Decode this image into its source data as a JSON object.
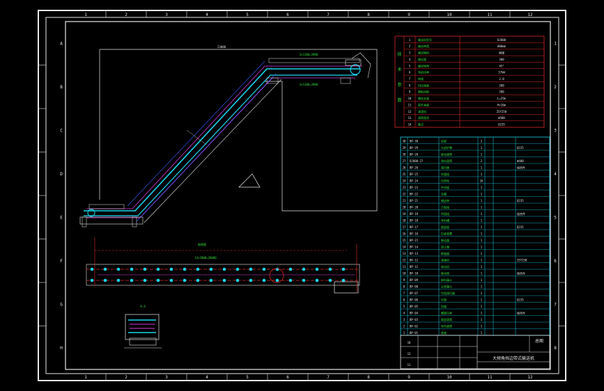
{
  "drawing": {
    "title_block": {
      "drawing_title": "大倾角挡边带式输送机",
      "rows": [
        "18",
        "12",
        "11"
      ],
      "mark": "总图"
    },
    "border": {
      "columns": [
        "1",
        "2",
        "3",
        "4",
        "5",
        "6",
        "7",
        "8",
        "9",
        "10",
        "11",
        "12"
      ],
      "rows": [
        "A",
        "B",
        "C",
        "D",
        "E",
        "F",
        "G",
        "H"
      ]
    },
    "tech_table": {
      "rows": [
        {
          "no": "1",
          "name": "输送机型号",
          "value": "DJ800"
        },
        {
          "no": "2",
          "name": "输送带宽",
          "value": "800mm"
        },
        {
          "no": "3",
          "name": "输送物料",
          "value": "原煤"
        },
        {
          "no": "4",
          "name": "输送量",
          "value": "300"
        },
        {
          "no": "5",
          "name": "输送倾角",
          "value": "45°"
        },
        {
          "no": "6",
          "name": "电机功率",
          "value": "37kW"
        },
        {
          "no": "7",
          "name": "带速",
          "value": "2.0"
        },
        {
          "no": "8",
          "name": "挡边高度",
          "value": "200"
        },
        {
          "no": "9",
          "name": "隔板间距",
          "value": "280"
        },
        {
          "no": "10",
          "name": "输送长度",
          "value": "L=25m"
        },
        {
          "no": "11",
          "name": "提升高度",
          "value": "H=16m"
        },
        {
          "no": "12",
          "name": "减速机",
          "value": "ZSY250"
        },
        {
          "no": "13",
          "name": "滚筒直径",
          "value": "Φ500"
        },
        {
          "no": "14",
          "name": "备注",
          "value": "Q235"
        }
      ],
      "side_label": [
        "技",
        "术",
        "参",
        "数"
      ]
    },
    "dims": {
      "top_overall": "23000",
      "upper_beam": "3×1300=3900",
      "lower_beam": "3×1300=3900",
      "plan_span": "14×2000=28000",
      "section": "A-A",
      "plan_title": "俯视图"
    },
    "parts_list": [
      {
        "no": "30",
        "code": "BP-30",
        "name": "机架",
        "qty": "2",
        "note": ""
      },
      {
        "no": "29",
        "code": "BP-29",
        "name": "头部护罩",
        "qty": "1",
        "note": "Q235"
      },
      {
        "no": "28",
        "code": "BP-28",
        "name": "驱动滚筒",
        "qty": "1",
        "note": ""
      },
      {
        "no": "27",
        "code": "DJ800-27",
        "name": "改向滚筒",
        "qty": "2",
        "note": "Φ400"
      },
      {
        "no": "26",
        "code": "BP-26",
        "name": "清扫器",
        "qty": "1",
        "note": "组合件"
      },
      {
        "no": "25",
        "code": "BP-25",
        "name": "托辊组",
        "qty": "1",
        "note": ""
      },
      {
        "no": "24",
        "code": "BP-24",
        "name": "压带轮",
        "qty": "16",
        "note": ""
      },
      {
        "no": "23",
        "code": "BP-23",
        "name": "中间架",
        "qty": "1",
        "note": ""
      },
      {
        "no": "22",
        "code": "BP-22",
        "name": "支腿",
        "qty": "1",
        "note": ""
      },
      {
        "no": "21",
        "code": "BP-21",
        "name": "输送带",
        "qty": "1",
        "note": "Q235"
      },
      {
        "no": "20",
        "code": "BP-20",
        "name": "凸弧段",
        "qty": "1",
        "note": ""
      },
      {
        "no": "19",
        "code": "BP-19",
        "name": "凹弧段",
        "qty": "1",
        "note": "组合件"
      },
      {
        "no": "18",
        "code": "BP-18",
        "name": "导料槽",
        "qty": "1",
        "note": ""
      },
      {
        "no": "17",
        "code": "BP-17",
        "name": "尾部架",
        "qty": "1",
        "note": "Q235"
      },
      {
        "no": "16",
        "code": "BP-16",
        "name": "拉紧装置",
        "qty": "1",
        "note": ""
      },
      {
        "no": "15",
        "code": "BP-15",
        "name": "制动器",
        "qty": "1",
        "note": ""
      },
      {
        "no": "14",
        "code": "BP-14",
        "name": "逆止器",
        "qty": "1",
        "note": ""
      },
      {
        "no": "13",
        "code": "BP-13",
        "name": "联轴器",
        "qty": "1",
        "note": ""
      },
      {
        "no": "12",
        "code": "BP-12",
        "name": "减速机",
        "qty": "1",
        "note": "ZSY250"
      },
      {
        "no": "11",
        "code": "BP-11",
        "name": "电动机",
        "qty": "1",
        "note": ""
      },
      {
        "no": "10",
        "code": "BP-10",
        "name": "驱动架",
        "qty": "1",
        "note": "组合件"
      },
      {
        "no": "9",
        "code": "BP-09",
        "name": "卸料漏斗",
        "qty": "1",
        "note": ""
      },
      {
        "no": "8",
        "code": "BP-08",
        "name": "头部漏斗",
        "qty": "1",
        "note": ""
      },
      {
        "no": "7",
        "code": "BP-07",
        "name": "空段清扫器",
        "qty": "1",
        "note": ""
      },
      {
        "no": "6",
        "code": "BP-06",
        "name": "托辊",
        "qty": "1",
        "note": "Q235"
      },
      {
        "no": "5",
        "code": "BP-05",
        "name": "挡辊",
        "qty": "1",
        "note": ""
      },
      {
        "no": "4",
        "code": "BP-04",
        "name": "螺旋拉紧",
        "qty": "1",
        "note": "组合件"
      },
      {
        "no": "3",
        "code": "BP-03",
        "name": "尾部滚筒",
        "qty": "1",
        "note": ""
      },
      {
        "no": "2",
        "code": "BP-02",
        "name": "导向滚筒",
        "qty": "1",
        "note": ""
      },
      {
        "no": "1",
        "code": "BP-01",
        "name": "底座",
        "qty": "1",
        "note": ""
      }
    ]
  },
  "colors": {
    "background": "#000000",
    "line": "#e8e8e8",
    "belt": "#19d8ee",
    "belt_inner": "#d63ce0",
    "dimension": "#e12a2a",
    "text": "#32e03c"
  }
}
